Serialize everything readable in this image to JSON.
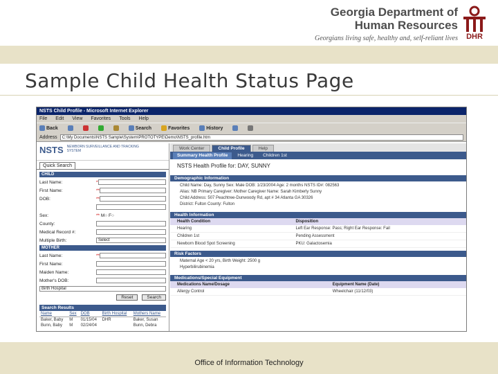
{
  "header": {
    "org_line1": "Georgia Department of",
    "org_line2": "Human Resources",
    "tagline": "Georgians living safe, healthy and, self-reliant lives",
    "logo_text": "DHR"
  },
  "slide_title": "Sample Child Health Status Page",
  "footer": "Office of Information Technology",
  "colors": {
    "band": "#e8e2c8",
    "app_blue": "#3c5a8c",
    "ie_title": "#0a246a"
  },
  "browser": {
    "title": "NSTS Child Profile - Microsoft Internet Explorer",
    "menu": [
      "File",
      "Edit",
      "View",
      "Favorites",
      "Tools",
      "Help"
    ],
    "toolbar": [
      "Back",
      "Search",
      "Favorites",
      "History"
    ],
    "address_label": "Address",
    "address": "C:\\My Documents\\NSTS Sample\\System\\PROTOTYPE\\Demo\\NSTS_profile.htm"
  },
  "app": {
    "brand": "NSTS",
    "brand_sub": "NEWBORN SURVEILLANCE AND TRACKING SYSTEM",
    "quick_search_tab": "Quick Search",
    "child_section": "CHILD",
    "mother_section": "MOTHER",
    "fields_child": [
      {
        "label": "Last Name:"
      },
      {
        "label": "First Name:"
      },
      {
        "label": "DOB:"
      },
      {
        "label": "Sex:"
      },
      {
        "label": "County:"
      },
      {
        "label": "Medical Record #:"
      },
      {
        "label": "Multiple Birth:"
      }
    ],
    "fields_mother": [
      {
        "label": "Last Name:"
      },
      {
        "label": "First Name:"
      },
      {
        "label": "Maiden Name:"
      },
      {
        "label": "Mother's DOB:"
      }
    ],
    "select_value": "Select",
    "birth_hospital": "Birth Hospital",
    "reset_button": "Reset",
    "search_button": "Search",
    "search_results": {
      "heading": "Search Results",
      "columns": [
        "Name",
        "Sex",
        "DOB",
        "Birth Hospital",
        "Mothers Name"
      ],
      "rows": [
        [
          "Baker, Baby",
          "M",
          "01/15/04",
          "DHR",
          "Baker, Susan"
        ],
        [
          "Bunn, Baby",
          "M",
          "02/24/04",
          "",
          "Bunn, Debra"
        ]
      ]
    },
    "tabs": [
      "Work Center",
      "Child Profile",
      "Help"
    ],
    "active_tab": 1,
    "subtabs": [
      "Summary Health Profile",
      "Hearing",
      "Children 1st"
    ],
    "active_subtab": 0,
    "profile_title": "NSTS Health Profile for: DAY, SUNNY",
    "demographic": {
      "heading": "Demographic Information",
      "lines": [
        "Child Name: Day, Sunny    Sex: Male    DOB: 1/23/2004    Age: 2 months  NSTS ID#: 082563",
        "Alias: NB Primary Caregiver: Mother  Caregiver Name: Sarah Kimberly Sunny",
        "Child Address: 507 Peachtree-Dunwoody Rd, apt # 34  Atlanta GA 30326",
        "District: Fulton  County: Fulton"
      ]
    },
    "health": {
      "heading": "Health Information",
      "columns": [
        "Health Condition",
        "Disposition"
      ],
      "rows": [
        [
          "Hearing",
          "Left Ear Response: Pass; Right Ear Response: Fail"
        ],
        [
          "Children 1st",
          "Pending Assessment"
        ],
        [
          "Newborn Blood Spot Screening",
          "PKU: Galactosemia"
        ]
      ]
    },
    "risk": {
      "heading": "Risk Factors",
      "lines": [
        "Maternal Age < 20 yrs, Birth Weight: 2500 g",
        "Hyperbilirubinemia"
      ]
    },
    "medications": {
      "heading": "Medications/Special Equipment",
      "columns": [
        "Medications Name/Dosage",
        "Equipment Name (Date)"
      ],
      "rows": [
        [
          "Allergy Control",
          "Wheelchair (11/12/03)"
        ]
      ]
    }
  }
}
